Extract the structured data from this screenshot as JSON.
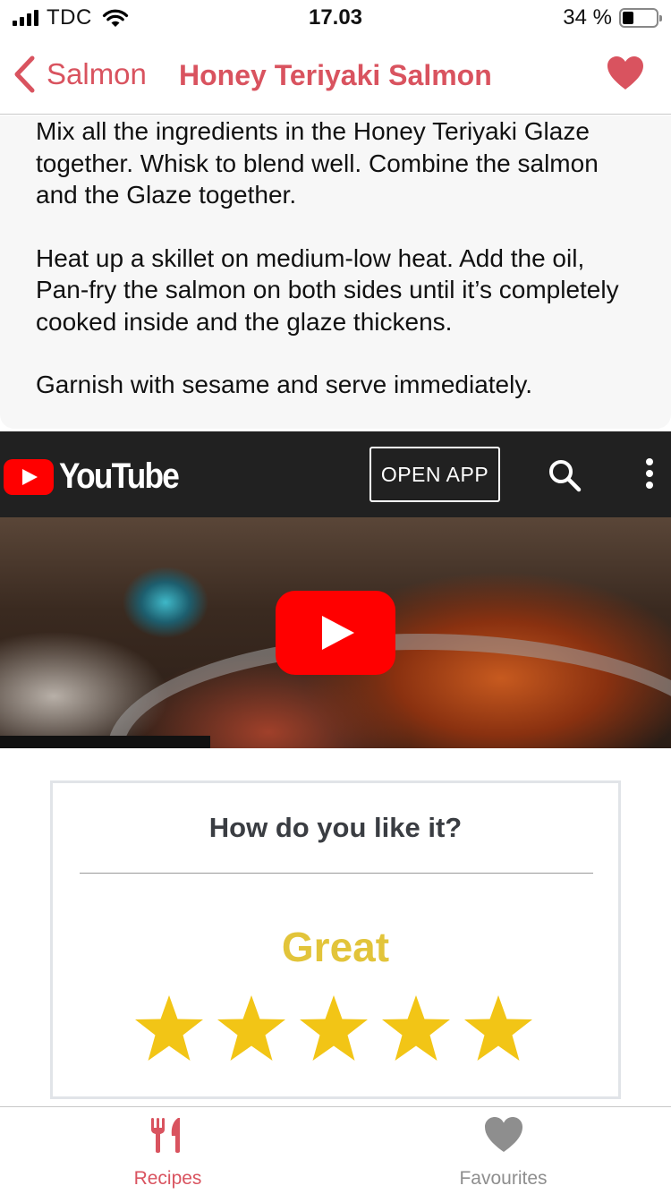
{
  "status_bar": {
    "carrier": "TDC",
    "time": "17.03",
    "battery_percent": "34 %",
    "battery_level": 0.34
  },
  "nav": {
    "back_label": "Salmon",
    "title": "Honey Teriyaki Salmon",
    "favourite_icon": "heart-icon"
  },
  "instructions": {
    "paragraphs": [
      "Mix all the ingredients in the Honey Teriyaki Glaze together. Whisk to blend well. Combine the salmon and the Glaze together.",
      "Heat up a skillet on medium-low heat. Add the oil, Pan-fry the salmon on both sides until it’s completely cooked inside and the glaze thickens.",
      "Garnish with sesame and serve immediately."
    ]
  },
  "youtube": {
    "logo_text": "YouTube",
    "open_app_label": "OPEN APP"
  },
  "rating": {
    "question": "How do you like it?",
    "word": "Great",
    "stars": 5,
    "max_stars": 5
  },
  "tabs": [
    {
      "label": "Recipes",
      "icon": "fork-knife-icon",
      "active": true
    },
    {
      "label": "Favourites",
      "icon": "heart-icon",
      "active": false
    }
  ],
  "colors": {
    "accent": "#d9535f",
    "star": "#f2c516",
    "rating_word": "#e2c43a",
    "inactive_tab": "#8e8e8e",
    "youtube_red": "#ff0000"
  }
}
